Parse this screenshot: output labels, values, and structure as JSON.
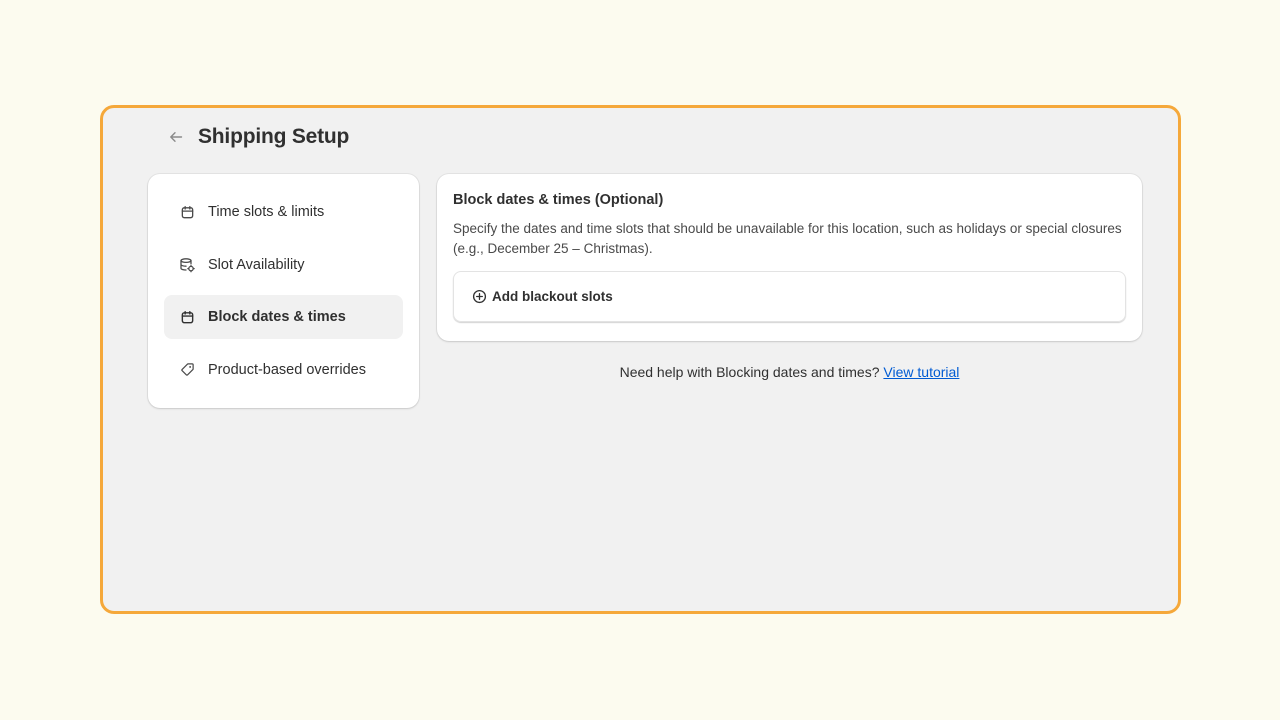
{
  "header": {
    "title": "Shipping Setup"
  },
  "sidebar": {
    "items": [
      {
        "label": "Time slots & limits",
        "icon": "calendar-icon",
        "active": false
      },
      {
        "label": "Slot Availability",
        "icon": "database-settings-icon",
        "active": false
      },
      {
        "label": "Block dates & times",
        "icon": "calendar-icon",
        "active": true
      },
      {
        "label": "Product-based overrides",
        "icon": "tag-icon",
        "active": false
      }
    ]
  },
  "card": {
    "title": "Block dates & times (Optional)",
    "description": "Specify the dates and time slots that should be unavailable for this location, such as holidays or special closures (e.g., December 25 – Christmas).",
    "add_button_label": "Add blackout slots"
  },
  "help": {
    "text": "Need help with Blocking dates and times?",
    "link_label": "View tutorial"
  },
  "colors": {
    "accent_border": "#f5a83a",
    "link": "#005bd3",
    "page_background": "#fcfbef",
    "panel_background": "#f1f1f1"
  }
}
